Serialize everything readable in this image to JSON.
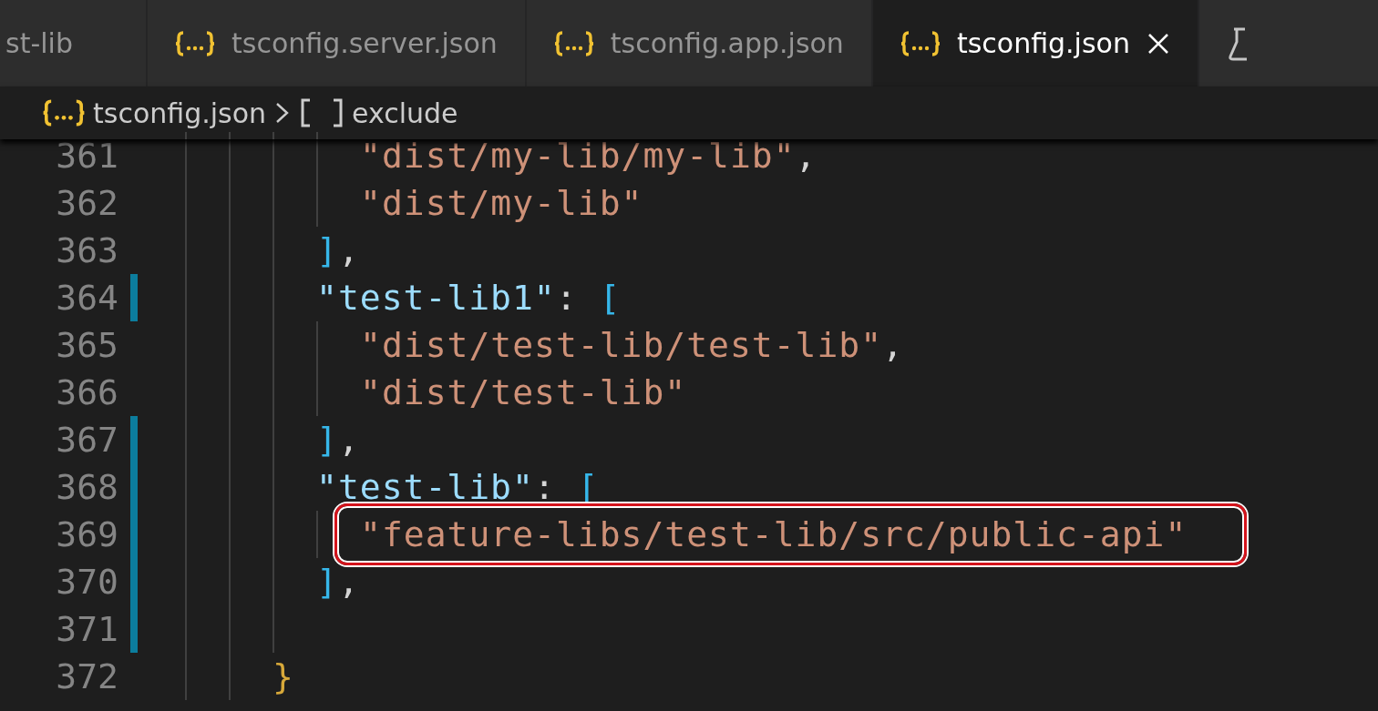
{
  "tabs": [
    {
      "label": "st-lib",
      "icon": false,
      "selected": false
    },
    {
      "label": "tsconfig.server.json",
      "icon": true,
      "selected": false
    },
    {
      "label": "tsconfig.app.json",
      "icon": true,
      "selected": false
    },
    {
      "label": "tsconfig.json",
      "icon": true,
      "selected": true
    }
  ],
  "breadcrumb": {
    "file": "tsconfig.json",
    "symbol": "exclude"
  },
  "lines": [
    {
      "number": "361",
      "modified": false,
      "highlighted": false,
      "tokens": [
        {
          "kind": "string",
          "text": "\"dist/my-lib/my-lib\""
        },
        {
          "kind": "punct",
          "text": ","
        }
      ]
    },
    {
      "number": "362",
      "modified": false,
      "highlighted": false,
      "tokens": [
        {
          "kind": "string",
          "text": "\"dist/my-lib\""
        }
      ]
    },
    {
      "number": "363",
      "modified": false,
      "highlighted": false,
      "tokens": [
        {
          "kind": "bracket",
          "text": "]"
        },
        {
          "kind": "punct",
          "text": ","
        }
      ]
    },
    {
      "number": "364",
      "modified": true,
      "highlighted": false,
      "tokens": [
        {
          "kind": "key",
          "text": "\"test-lib1\""
        },
        {
          "kind": "punct",
          "text": ": "
        },
        {
          "kind": "bracket",
          "text": "["
        }
      ]
    },
    {
      "number": "365",
      "modified": false,
      "highlighted": false,
      "tokens": [
        {
          "kind": "string",
          "text": "\"dist/test-lib/test-lib\""
        },
        {
          "kind": "punct",
          "text": ","
        }
      ]
    },
    {
      "number": "366",
      "modified": false,
      "highlighted": false,
      "tokens": [
        {
          "kind": "string",
          "text": "\"dist/test-lib\""
        }
      ]
    },
    {
      "number": "367",
      "modified": true,
      "highlighted": false,
      "tokens": [
        {
          "kind": "bracket",
          "text": "]"
        },
        {
          "kind": "punct",
          "text": ","
        }
      ]
    },
    {
      "number": "368",
      "modified": true,
      "highlighted": false,
      "tokens": [
        {
          "kind": "key",
          "text": "\"test-lib\""
        },
        {
          "kind": "punct",
          "text": ": "
        },
        {
          "kind": "bracket",
          "text": "["
        }
      ]
    },
    {
      "number": "369",
      "modified": true,
      "highlighted": true,
      "tokens": [
        {
          "kind": "string",
          "text": "\"feature-libs/test-lib/src/public-api\""
        }
      ]
    },
    {
      "number": "370",
      "modified": true,
      "highlighted": false,
      "tokens": [
        {
          "kind": "bracket",
          "text": "]"
        },
        {
          "kind": "punct",
          "text": ","
        }
      ]
    },
    {
      "number": "371",
      "modified": true,
      "highlighted": false
    },
    {
      "number": "372",
      "modified": false,
      "highlighted": false,
      "tokens": [
        {
          "kind": "brace",
          "text": "}"
        }
      ]
    }
  ]
}
